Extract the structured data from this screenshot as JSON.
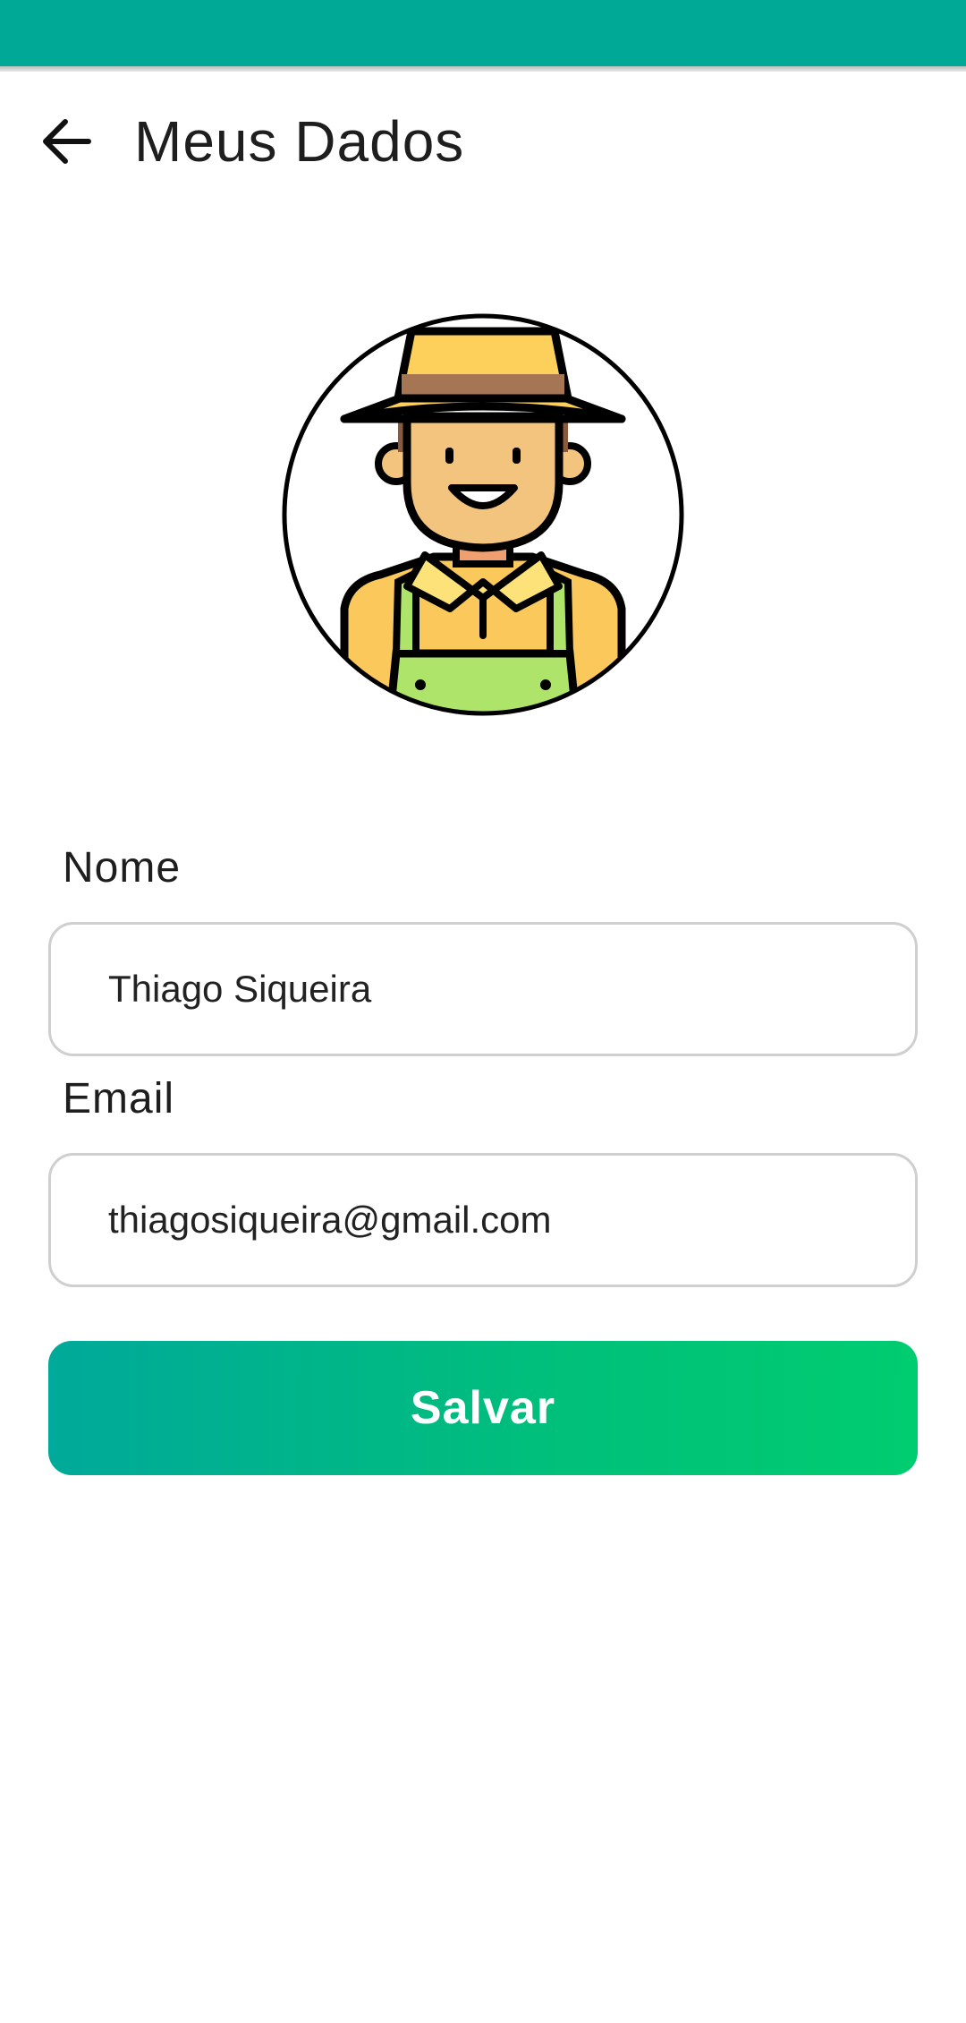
{
  "app_bar": {
    "title": "Meus Dados",
    "back_icon": "arrow-left-icon"
  },
  "profile": {
    "avatar_icon": "farmer-avatar-icon"
  },
  "form": {
    "name_label": "Nome",
    "name_value": "Thiago Siqueira",
    "email_label": "Email",
    "email_value": "thiagosiqueira@gmail.com",
    "save_label": "Salvar"
  },
  "colors": {
    "status_bar": "#00a896",
    "button_start": "#00a99a",
    "button_end": "#00cc70",
    "field_border": "#cfcfcf"
  }
}
